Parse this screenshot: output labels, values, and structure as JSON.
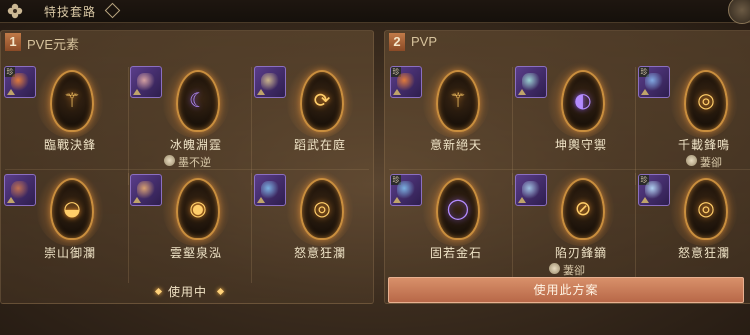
{
  "header": {
    "title": "特技套路"
  },
  "panels": [
    {
      "number": "1",
      "title": "PVE元素",
      "status": "使用中",
      "cells": [
        {
          "name": "臨戰決鋒",
          "glyph": "⚚",
          "glyph_style": "gold",
          "gear_color": "#e07a3a"
        },
        {
          "name": "冰魄淵霆",
          "glyph": "☾",
          "glyph_style": "purple",
          "gear_color": "#d4a0a0",
          "sub": "墨不逆"
        },
        {
          "name": "蹈武在庭",
          "glyph": "⟳",
          "glyph_style": "gold",
          "gear_color": "#c9b38a"
        },
        {
          "name": "崇山御瀾",
          "glyph": "◒",
          "glyph_style": "gold",
          "gear_color": "#c07050"
        },
        {
          "name": "雲壑泉泓",
          "glyph": "◉",
          "glyph_style": "gold",
          "gear_color": "#d8a070"
        },
        {
          "name": "怒意狂瀾",
          "glyph": "◎",
          "glyph_style": "gold",
          "gear_color": "#7ab0e0"
        }
      ]
    },
    {
      "number": "2",
      "title": "PVP",
      "action": "使用此方案",
      "cells": [
        {
          "name": "意新絕天",
          "glyph": "⚚",
          "glyph_style": "gold",
          "gear_color": "#e07a3a"
        },
        {
          "name": "坤輿守禦",
          "glyph": "◐",
          "glyph_style": "purple",
          "gear_color": "#9ad0d0"
        },
        {
          "name": "千載鋒鳴",
          "glyph": "◎",
          "glyph_style": "gold",
          "gear_color": "#80a8e0",
          "sub": "萋卻"
        },
        {
          "name": "固若金石",
          "glyph": "◯",
          "glyph_style": "purple",
          "gear_color": "#7ab0e0"
        },
        {
          "name": "陷刃鋒鏑",
          "glyph": "⊘",
          "glyph_style": "gold",
          "gear_color": "#a0c0e0",
          "sub": "萋卻"
        },
        {
          "name": "怒意狂瀾",
          "glyph": "◎",
          "glyph_style": "gold",
          "gear_color": "#b0d0f0"
        }
      ]
    }
  ]
}
